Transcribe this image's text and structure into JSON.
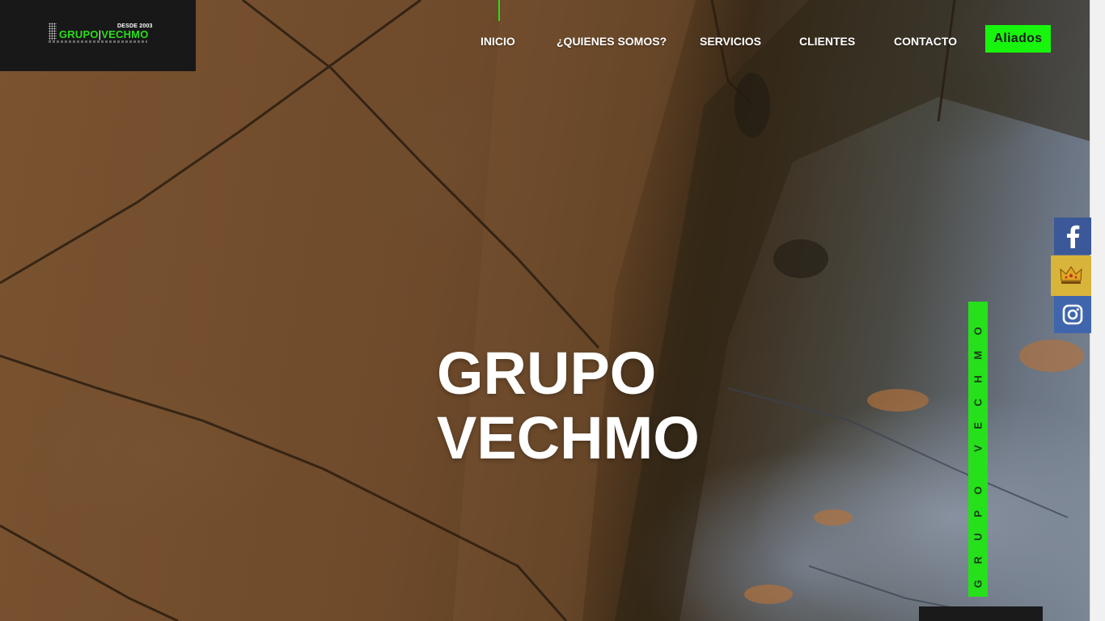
{
  "logo": {
    "since": "DESDE 2003",
    "name_part1": "GRUPO",
    "name_part2": "VECHMO"
  },
  "nav": {
    "items": [
      {
        "label": "INICIO",
        "active": true
      },
      {
        "label": "¿QUIENES SOMOS?"
      },
      {
        "label": "SERVICIOS"
      },
      {
        "label": "CLIENTES"
      },
      {
        "label": "CONTACTO"
      }
    ],
    "cta_label": "Aliados"
  },
  "hero": {
    "line1": "GRUPO",
    "line2": "VECHMO"
  },
  "side_tag": "GRUPO VECHMO",
  "social": [
    {
      "icon": "facebook-icon",
      "color": "#3b5998"
    },
    {
      "icon": "crown-app-icon",
      "color": "#d9b43a"
    },
    {
      "icon": "instagram-icon",
      "color": "#3f66ad"
    }
  ],
  "colors": {
    "accent_green": "#18f50d",
    "logo_bg": "#181818"
  }
}
